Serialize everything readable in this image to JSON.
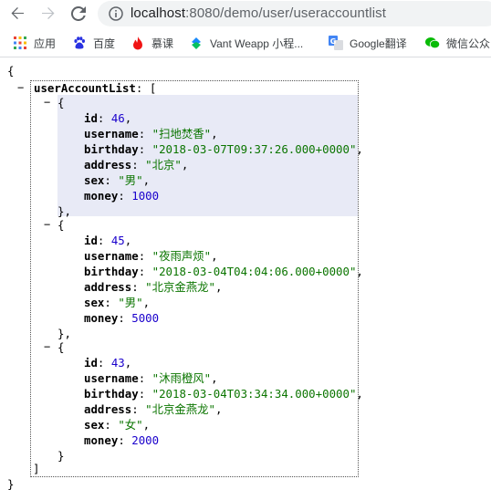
{
  "browser": {
    "url_host": "localhost",
    "url_path": ":8080/demo/user/useraccountlist",
    "bookmarks": [
      "应用",
      "百度",
      "慕课",
      "Vant Weapp 小程...",
      "Google翻译",
      "微信公众"
    ]
  },
  "json": {
    "open_brace": "{",
    "close_brace": "}",
    "array_key": "userAccountList",
    "array_open": ": [",
    "array_close": "]",
    "item_open": "{",
    "item_close_comma": "},",
    "item_close": "}",
    "toggle": "−",
    "items": [
      {
        "id": "46",
        "username": "\"扫地焚香\"",
        "birthday": "\"2018-03-07T09:37:26.000+0000\"",
        "address": "\"北京\"",
        "sex": "\"男\"",
        "money": "1000"
      },
      {
        "id": "45",
        "username": "\"夜雨声烦\"",
        "birthday": "\"2018-03-04T04:04:06.000+0000\"",
        "address": "\"北京金燕龙\"",
        "sex": "\"男\"",
        "money": "5000"
      },
      {
        "id": "43",
        "username": "\"沐雨橙风\"",
        "birthday": "\"2018-03-04T03:34:34.000+0000\"",
        "address": "\"北京金燕龙\"",
        "sex": "\"女\"",
        "money": "2000"
      }
    ],
    "labels": {
      "id": "id",
      "username": "username",
      "birthday": "birthday",
      "address": "address",
      "sex": "sex",
      "money": "money"
    }
  },
  "colors": {
    "key": "#000000",
    "string": "#0b7500",
    "number": "#1a01cc",
    "highlight": "#e8eaf6"
  }
}
